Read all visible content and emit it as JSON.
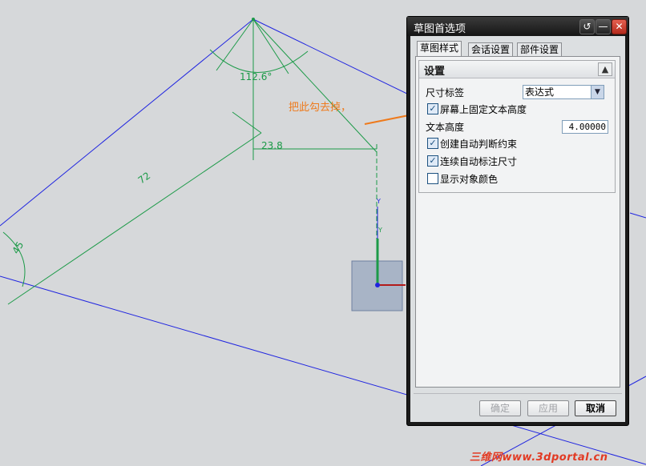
{
  "window": {
    "title": "草图首选项"
  },
  "tabs": [
    {
      "label": "草图样式",
      "active": true
    },
    {
      "label": "会话设置",
      "active": false
    },
    {
      "label": "部件设置",
      "active": false
    }
  ],
  "settings": {
    "section_title": "设置",
    "dimension_label": {
      "label": "尺寸标签",
      "value": "表达式"
    },
    "fixed_text_height": {
      "label": "屏幕上固定文本高度",
      "checked": true
    },
    "text_height": {
      "label": "文本高度",
      "value": "4.00000"
    },
    "auto_constraints": {
      "label": "创建自动判断约束",
      "checked": true
    },
    "continuous_auto_dim": {
      "label": "连续自动标注尺寸",
      "checked": true
    },
    "show_object_color": {
      "label": "显示对象颜色",
      "checked": false
    }
  },
  "footer": {
    "ok": "确定",
    "apply": "应用",
    "cancel": "取消"
  },
  "annotation": {
    "text": "把此勾去掉，",
    "color": "#ee7a1c"
  },
  "drawing": {
    "dim_angle": "112.6°",
    "dim_horizontal": "23.8",
    "dim_length": "72",
    "dim_angle_small": "45",
    "axis_y1": "Y",
    "axis_y2": "Y",
    "axis_x": "X"
  },
  "watermark": "三维网www.3dportal.cn",
  "colors": {
    "sketch_blue": "#1f24e0",
    "dim_green": "#1c9a48",
    "highlight": "#ee7a1c"
  }
}
